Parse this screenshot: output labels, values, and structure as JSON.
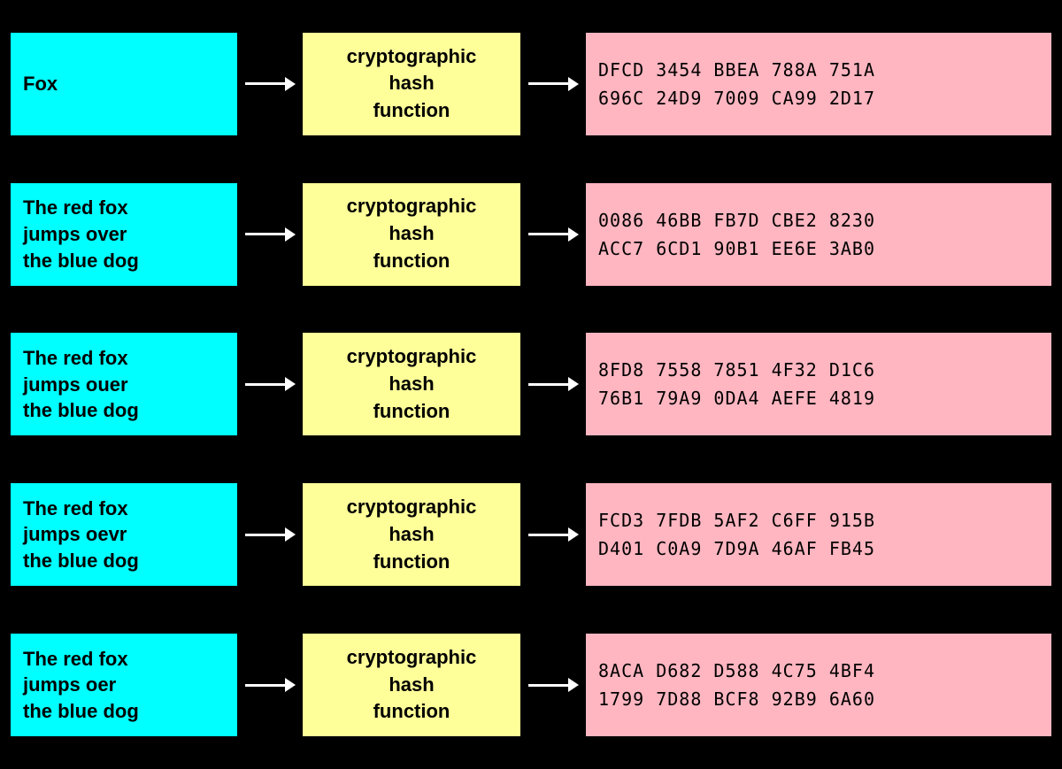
{
  "rows": [
    {
      "id": "row-1",
      "input": "Fox",
      "hash_label": "cryptographic\nhash\nfunction",
      "output_line1": "DFCD  3454  BBEA  788A  751A",
      "output_line2": "696C  24D9  7009  CA99  2D17"
    },
    {
      "id": "row-2",
      "input": "The red fox\njumps over\nthe blue dog",
      "hash_label": "cryptographic\nhash\nfunction",
      "output_line1": "0086  46BB  FB7D  CBE2  8230",
      "output_line2": "ACC7  6CD1  90B1  EE6E  3AB0"
    },
    {
      "id": "row-3",
      "input": "The red fox\njumps ouer\nthe blue dog",
      "hash_label": "cryptographic\nhash\nfunction",
      "output_line1": "8FD8  7558  7851  4F32  D1C6",
      "output_line2": "76B1  79A9  0DA4  AEFE  4819"
    },
    {
      "id": "row-4",
      "input": "The red fox\njumps oevr\nthe blue dog",
      "hash_label": "cryptographic\nhash\nfunction",
      "output_line1": "FCD3  7FDB  5AF2  C6FF  915B",
      "output_line2": "D401  C0A9  7D9A  46AF  FB45"
    },
    {
      "id": "row-5",
      "input": "The red fox\njumps oer\nthe blue dog",
      "hash_label": "cryptographic\nhash\nfunction",
      "output_line1": "8ACA  D682  D588  4C75  4BF4",
      "output_line2": "1799  7D88  BCF8  92B9  6A60"
    }
  ],
  "colors": {
    "input_bg": "#00ffff",
    "hash_bg": "#ffff99",
    "output_bg": "#ffb6c1",
    "bg": "#000000",
    "arrow": "#ffffff"
  }
}
